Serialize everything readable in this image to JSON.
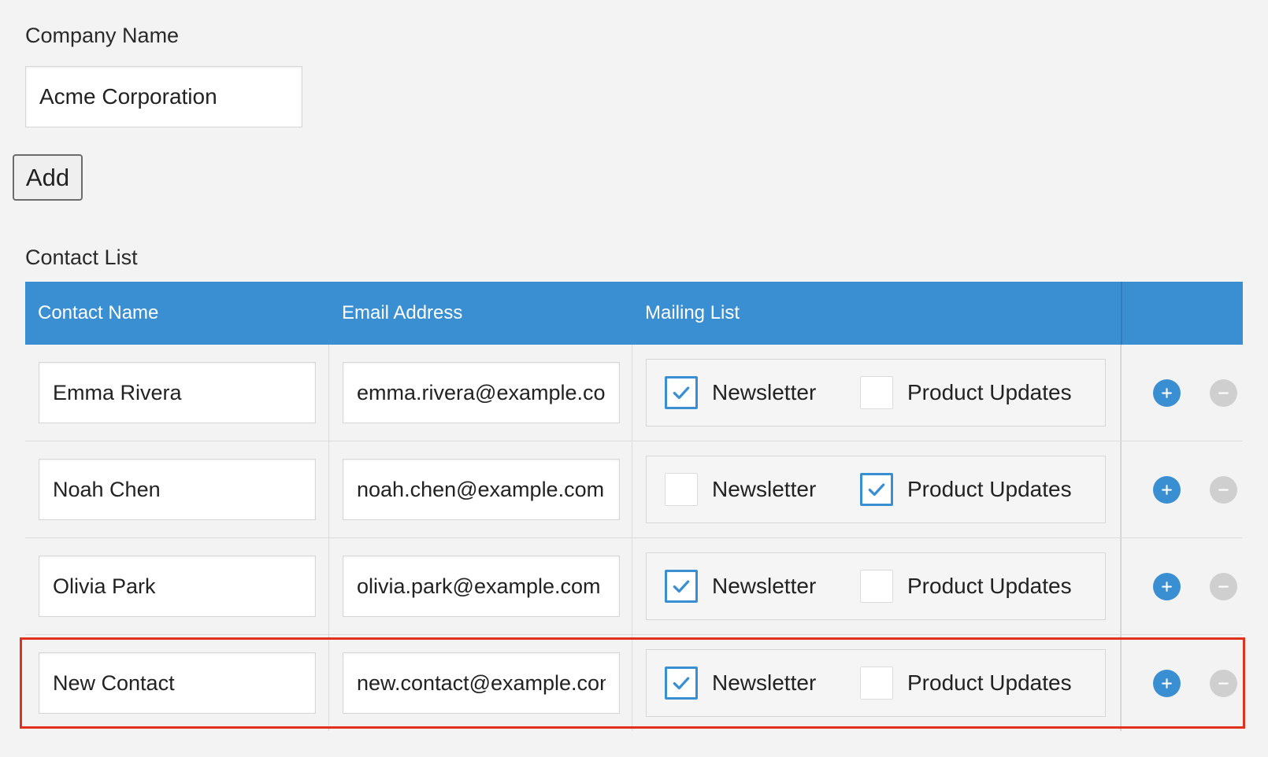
{
  "company": {
    "label": "Company Name",
    "value": "Acme Corporation"
  },
  "add_button_label": "Add",
  "contact_list": {
    "label": "Contact List",
    "columns": [
      "Contact Name",
      "Email Address",
      "Mailing List",
      ""
    ],
    "checkbox_labels": {
      "newsletter": "Newsletter",
      "updates": "Product Updates"
    },
    "rows": [
      {
        "name": "Emma Rivera",
        "email": "emma.rivera@example.com",
        "newsletter": true,
        "updates": false
      },
      {
        "name": "Noah Chen",
        "email": "noah.chen@example.com",
        "newsletter": false,
        "updates": true
      },
      {
        "name": "Olivia Park",
        "email": "olivia.park@example.com",
        "newsletter": true,
        "updates": false
      },
      {
        "name": "New Contact",
        "email": "new.contact@example.com",
        "newsletter": true,
        "updates": false
      }
    ],
    "highlighted_row": 3
  },
  "icons": {
    "add_row": "plus-circle-icon",
    "remove_row": "minus-circle-icon",
    "check": "checkmark-icon"
  },
  "colors": {
    "header_bg": "#3a8fd2",
    "accent": "#3a8fd2",
    "remove_disabled": "#cfcfcf",
    "highlight": "#e0321f",
    "page_bg": "#f3f3f3"
  }
}
